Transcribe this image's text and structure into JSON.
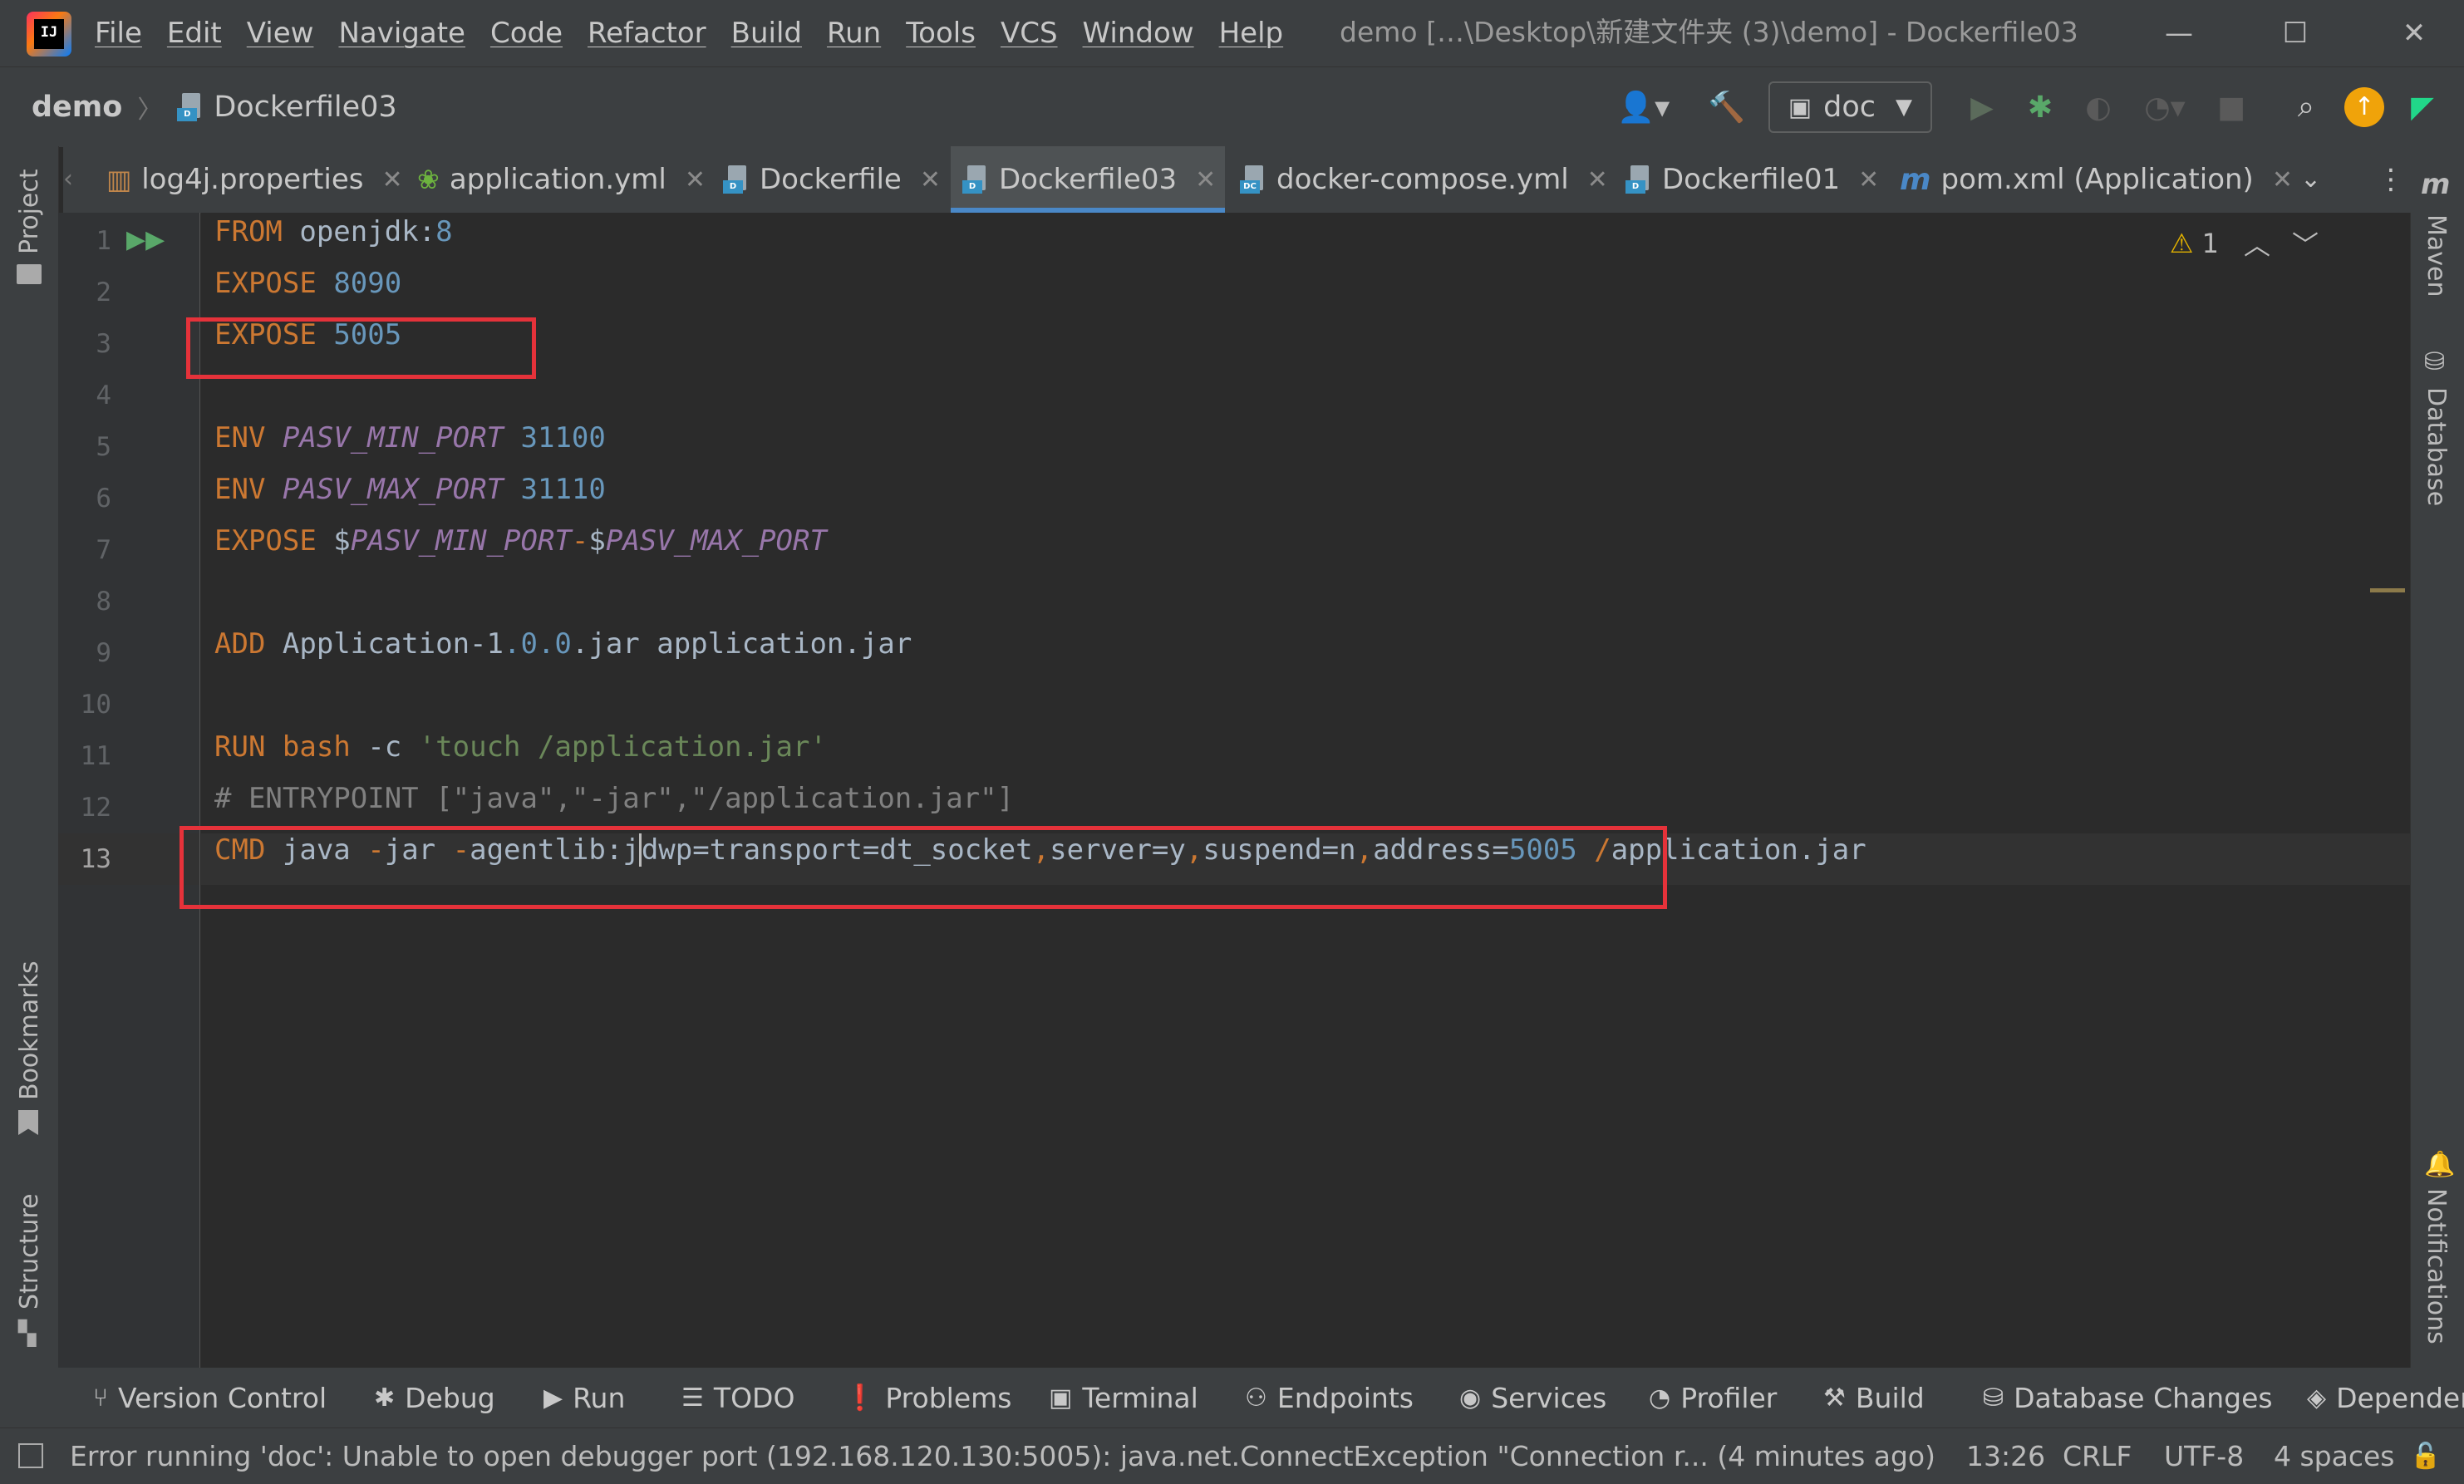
{
  "app": {
    "logo_text": "IJ",
    "window_title": "demo […\\Desktop\\新建文件夹 (3)\\demo] - Dockerfile03",
    "minimize": "—",
    "maximize": "☐",
    "close": "✕"
  },
  "menu": [
    "File",
    "Edit",
    "View",
    "Navigate",
    "Code",
    "Refactor",
    "Build",
    "Run",
    "Tools",
    "VCS",
    "Window",
    "Help"
  ],
  "breadcrumb": {
    "project": "demo",
    "file": "Dockerfile03"
  },
  "toolbar": {
    "run_config": "doc"
  },
  "tabs": [
    {
      "label": "log4j.properties",
      "active": false
    },
    {
      "label": "application.yml",
      "active": false
    },
    {
      "label": "Dockerfile",
      "active": false
    },
    {
      "label": "Dockerfile03",
      "active": true
    },
    {
      "label": "docker-compose.yml",
      "active": false
    },
    {
      "label": "Dockerfile01",
      "active": false
    },
    {
      "label": "pom.xml (Application)",
      "active": false
    }
  ],
  "left_panels": {
    "project": "Project",
    "bookmarks": "Bookmarks",
    "structure": "Structure"
  },
  "right_panels": {
    "maven": "Maven",
    "database": "Database",
    "notifications": "Notifications"
  },
  "editor": {
    "warnings_count": "1",
    "line_numbers": [
      "1",
      "2",
      "3",
      "4",
      "5",
      "6",
      "7",
      "8",
      "9",
      "10",
      "11",
      "12",
      "13"
    ],
    "current_line": "13",
    "lines": [
      "FROM openjdk:8",
      "EXPOSE 8090",
      "EXPOSE 5005",
      "",
      "ENV PASV_MIN_PORT 31100",
      "ENV PASV_MAX_PORT 31110",
      "EXPOSE $PASV_MIN_PORT-$PASV_MAX_PORT",
      "",
      "ADD Application-1.0.0.jar application.jar",
      "",
      "RUN bash -c 'touch /application.jar'",
      "# ENTRYPOINT [\"java\",\"-jar\",\"/application.jar\"]",
      "CMD java -jar -agentlib:jdwp=transport=dt_socket,server=y,suspend=n,address=5005 /application.jar"
    ]
  },
  "tool_windows": [
    "Version Control",
    "Debug",
    "Run",
    "TODO",
    "Problems",
    "Terminal",
    "Endpoints",
    "Services",
    "Profiler",
    "Build",
    "Database Changes",
    "Dependencies"
  ],
  "status": {
    "message": "Error running 'doc': Unable to open debugger port (192.168.120.130:5005): java.net.ConnectException \"Connection r... (4 minutes ago)",
    "position": "13:26",
    "line_sep": "CRLF",
    "encoding": "UTF-8",
    "indent": "4 spaces"
  },
  "colors": {
    "keyword": "#cc7832",
    "number": "#6897bb",
    "variable": "#9876aa",
    "string": "#6a8759",
    "comment": "#808080",
    "highlight_box": "#e5323a",
    "active_tab_underline": "#4a88c7"
  }
}
